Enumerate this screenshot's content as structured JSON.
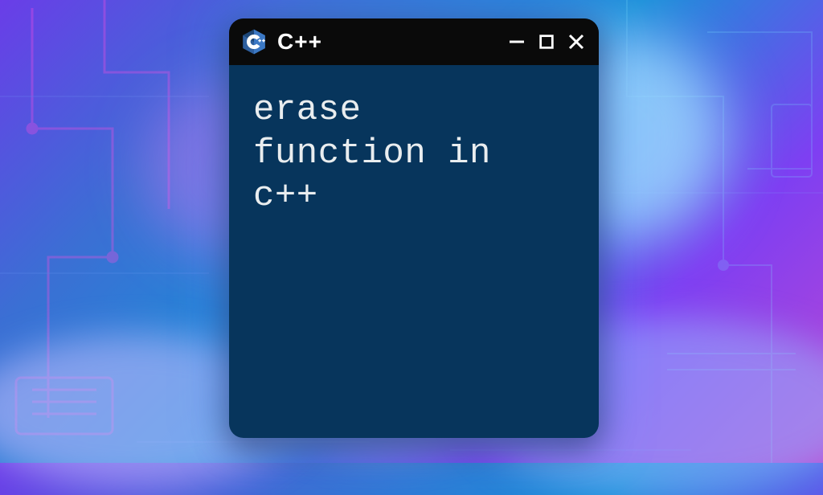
{
  "window": {
    "title": "C++",
    "icon_name": "cpp-logo-icon",
    "controls": {
      "minimize": "minimize-icon",
      "maximize": "maximize-icon",
      "close": "close-icon"
    }
  },
  "content": {
    "body_text": "erase\nfunction in\nc++"
  },
  "colors": {
    "titlebar_bg": "#0a0a0a",
    "window_bg": "#07355c",
    "text": "#e9edef",
    "icon_blue": "#2e5f9e",
    "icon_light": "#a7c7ea"
  }
}
